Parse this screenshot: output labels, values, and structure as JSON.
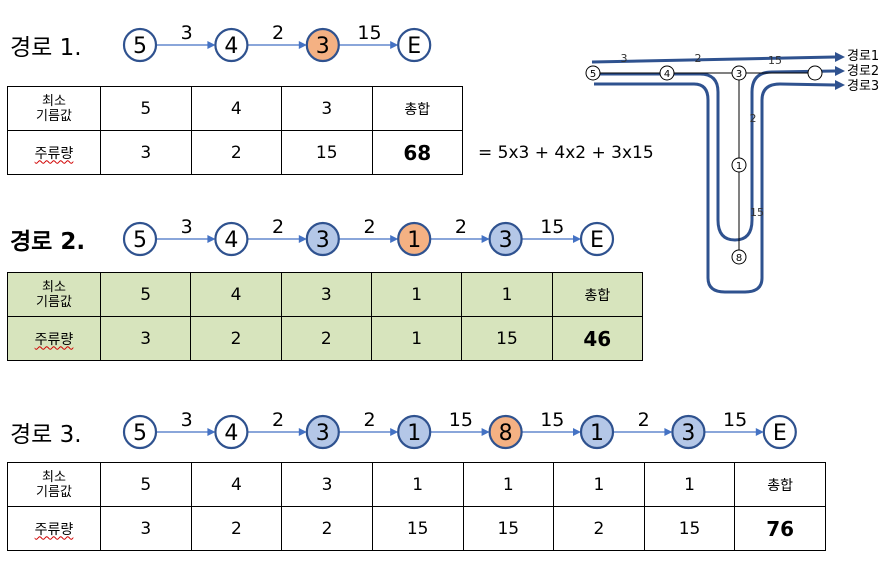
{
  "routes": [
    {
      "title": "경로 1.",
      "nodes": [
        "5",
        "4",
        "3",
        "E"
      ],
      "highlight": [
        2
      ],
      "weights": [
        "3",
        "2",
        "15"
      ],
      "table": {
        "row1_label": "최소\n기름값",
        "row1": [
          "5",
          "4",
          "3"
        ],
        "total_label": "총합",
        "row2_label": "주류량",
        "row2": [
          "3",
          "2",
          "15"
        ],
        "total": "68"
      },
      "formula": "= 5x3 + 4x2 + 3x15"
    },
    {
      "title": "경로 2.",
      "nodes": [
        "5",
        "4",
        "3",
        "1",
        "3",
        "E"
      ],
      "highlight": [
        3
      ],
      "weights": [
        "3",
        "2",
        "2",
        "2",
        "15"
      ],
      "table": {
        "row1_label": "최소\n기름값",
        "row1": [
          "5",
          "4",
          "3",
          "1",
          "1"
        ],
        "total_label": "총합",
        "row2_label": "주류량",
        "row2": [
          "3",
          "2",
          "2",
          "1",
          "15"
        ],
        "total": "46"
      }
    },
    {
      "title": "경로 3.",
      "nodes": [
        "5",
        "4",
        "3",
        "1",
        "8",
        "1",
        "3",
        "E"
      ],
      "highlight": [
        4
      ],
      "weights": [
        "3",
        "2",
        "2",
        "15",
        "15",
        "2",
        "15"
      ],
      "table": {
        "row1_label": "최소\n기름값",
        "row1": [
          "5",
          "4",
          "3",
          "1",
          "1",
          "1",
          "1"
        ],
        "total_label": "총합",
        "row2_label": "주류량",
        "row2": [
          "3",
          "2",
          "2",
          "15",
          "15",
          "2",
          "15"
        ],
        "total": "76"
      }
    }
  ],
  "map": {
    "nodes": [
      "5",
      "4",
      "3",
      "1",
      "8"
    ],
    "edge_labels": [
      "3",
      "2",
      "15",
      "2",
      "15"
    ],
    "route_labels": [
      "경로1",
      "경로2",
      "경로3"
    ]
  },
  "colors": {
    "node_stroke": "#2f528f",
    "highlight_orange": "#f4b183",
    "visited_blue": "#b4c7e7",
    "arrow_blue": "#4472c4",
    "table_green": "#d7e4bd",
    "map_route": "#2f528f"
  }
}
